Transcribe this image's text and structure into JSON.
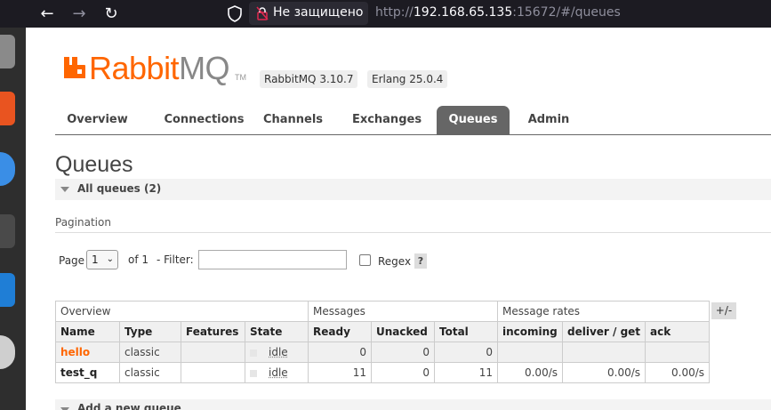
{
  "browser": {
    "security_label": "Не защищено",
    "url_scheme": "http://",
    "url_host": "192.168.65.135",
    "url_rest": ":15672/#/queues"
  },
  "brand": {
    "name_rabbit": "Rabbit",
    "name_mq": "MQ",
    "tm": "TM",
    "color": "#ff6600"
  },
  "versions": {
    "rabbitmq": "RabbitMQ 3.10.7",
    "erlang": "Erlang 25.0.4"
  },
  "tabs": [
    {
      "label": "Overview",
      "active": false
    },
    {
      "label": "Connections",
      "active": false
    },
    {
      "label": "Channels",
      "active": false
    },
    {
      "label": "Exchanges",
      "active": false
    },
    {
      "label": "Queues",
      "active": true
    },
    {
      "label": "Admin",
      "active": false
    }
  ],
  "page": {
    "title": "Queues",
    "all_queues_label": "All queues (2)",
    "pagination_label": "Pagination",
    "page_label": "Page",
    "page_value": "1",
    "of_label": "of 1",
    "filter_label": "- Filter:",
    "filter_value": "",
    "regex_label": "Regex",
    "help_label": "?",
    "columns_toggle": "+/-",
    "add_queue_label": "Add a new queue"
  },
  "table": {
    "groups": [
      "Overview",
      "Messages",
      "Message rates"
    ],
    "columns": [
      "Name",
      "Type",
      "Features",
      "State",
      "Ready",
      "Unacked",
      "Total",
      "incoming",
      "deliver / get",
      "ack"
    ],
    "rows": [
      {
        "name": "hello",
        "type": "classic",
        "features": "",
        "state": "idle",
        "ready": "0",
        "unacked": "0",
        "total": "0",
        "incoming": "",
        "deliver_get": "",
        "ack": ""
      },
      {
        "name": "test_q",
        "type": "classic",
        "features": "",
        "state": "idle",
        "ready": "11",
        "unacked": "0",
        "total": "11",
        "incoming": "0.00/s",
        "deliver_get": "0.00/s",
        "ack": "0.00/s"
      }
    ]
  }
}
